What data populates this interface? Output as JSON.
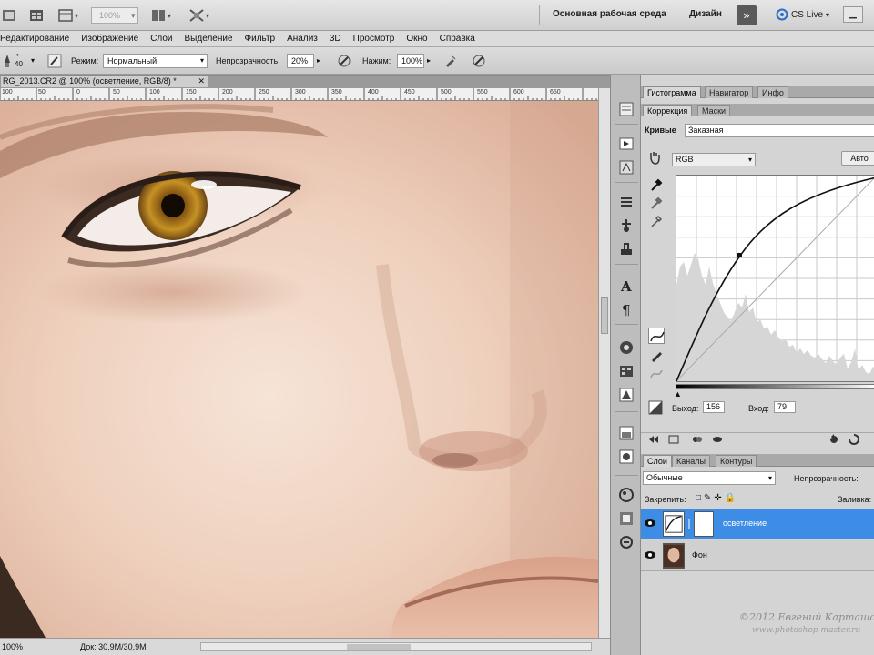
{
  "appbar": {
    "zoom": "100%",
    "workspace": "Основная рабочая среда",
    "design": "Дизайн",
    "cslive": "CS Live"
  },
  "menu": [
    "Редактирование",
    "Изображение",
    "Слои",
    "Выделение",
    "Фильтр",
    "Анализ",
    "3D",
    "Просмотр",
    "Окно",
    "Справка"
  ],
  "options": {
    "brush_size": "40",
    "mode_label": "Режим:",
    "mode_value": "Нормальный",
    "opacity_label": "Непрозрачность:",
    "opacity_value": "20%",
    "flow_label": "Нажим:",
    "flow_value": "100%"
  },
  "document": {
    "tab": "RG_2013.CR2 @ 100% (осветление, RGB/8) *",
    "close": "✕"
  },
  "ruler": [
    "100",
    "50",
    "0",
    "50",
    "100",
    "150",
    "200",
    "250",
    "300",
    "350",
    "400",
    "450",
    "500",
    "550",
    "600",
    "650"
  ],
  "status": {
    "zoom": "100%",
    "doc": "Док: 30,9M/30,9M"
  },
  "panels": {
    "top_tabs": [
      "Гистограмма",
      "Навигатор",
      "Инфо"
    ],
    "adj_tabs": [
      "Коррекция",
      "Маски"
    ],
    "curves_label": "Кривые",
    "preset": "Заказная",
    "channel": "RGB",
    "auto": "Авто",
    "output_label": "Выход:",
    "output_value": "156",
    "input_label": "Вход:",
    "input_value": "79",
    "layer_tabs": [
      "Слои",
      "Каналы",
      "Контуры"
    ],
    "blend": "Обычные",
    "opacity_label": "Непрозрачность:",
    "lock_label": "Закрепить:",
    "fill_label": "Заливка:",
    "layers": [
      {
        "name": "осветление",
        "selected": true
      },
      {
        "name": "Фон",
        "selected": false
      }
    ]
  },
  "watermark": "©2012 Евгений Карташов",
  "watermark2": "www.photoshop-master.ru",
  "colors": {
    "accent": "#3d8de6",
    "panel": "#d4d4d4"
  }
}
